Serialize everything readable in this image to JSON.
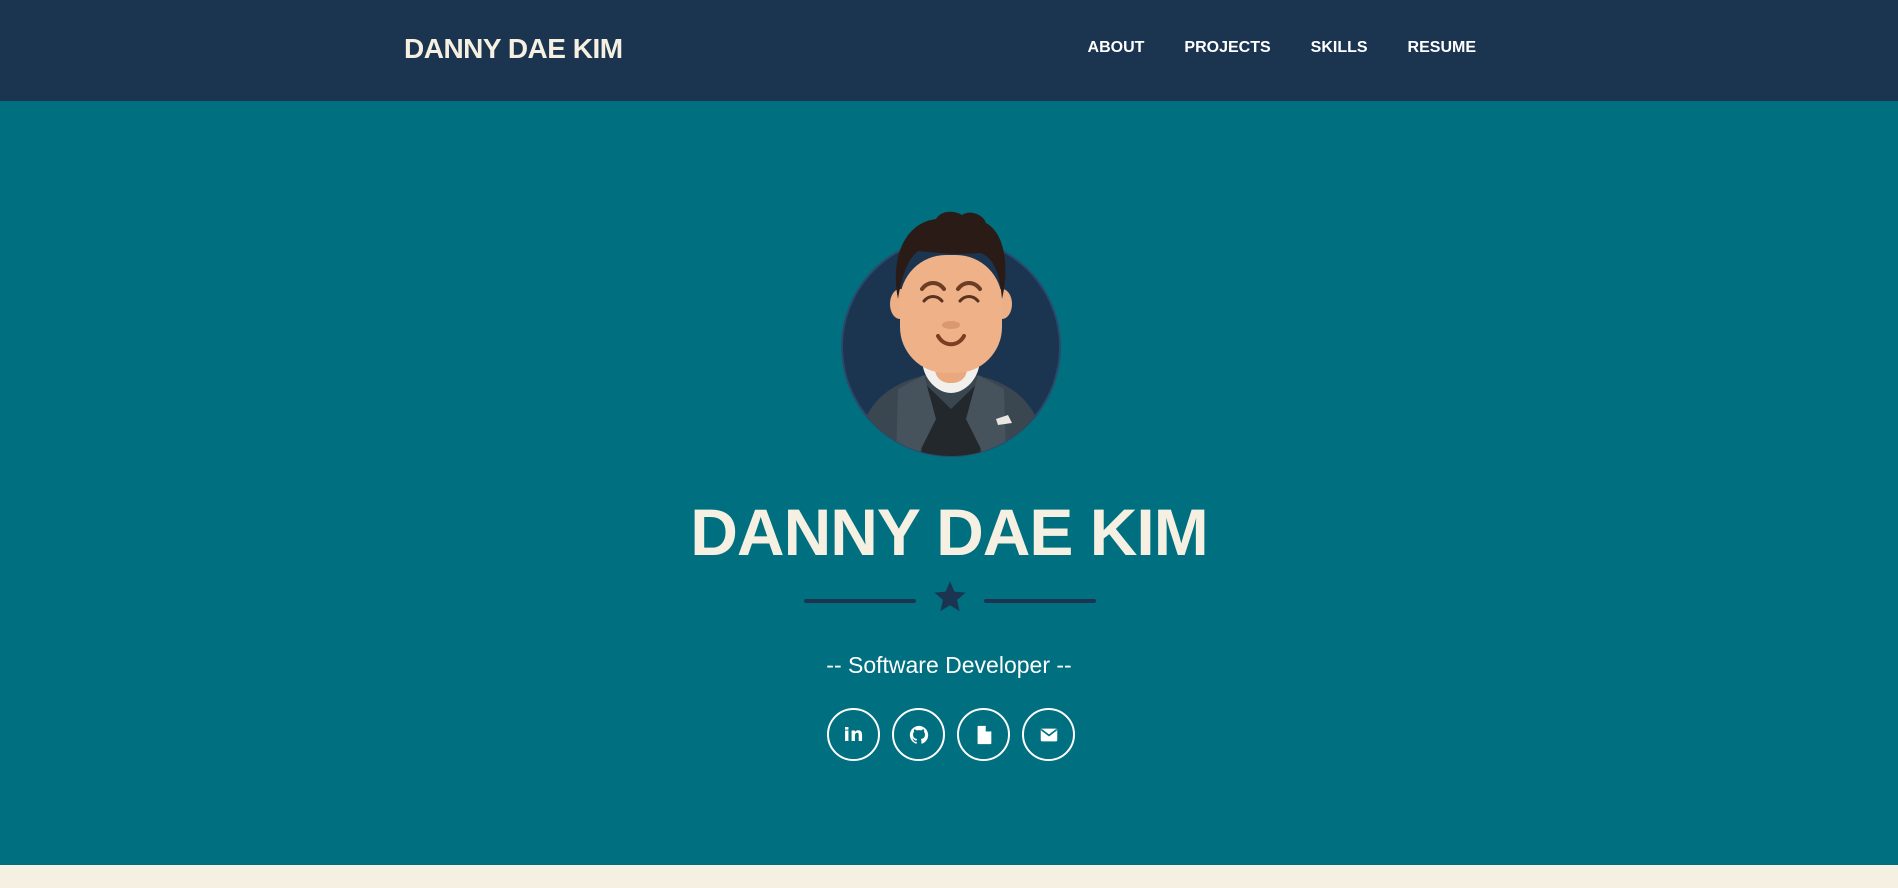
{
  "navbar": {
    "brand": "DANNY DAE KIM",
    "links": [
      "ABOUT",
      "PROJECTS",
      "SKILLS",
      "RESUME"
    ]
  },
  "hero": {
    "title": "DANNY DAE KIM",
    "subtitle": "-- Software Developer --",
    "social": [
      {
        "icon": "linkedin-icon",
        "text": "in"
      },
      {
        "icon": "github-icon"
      },
      {
        "icon": "document-icon"
      },
      {
        "icon": "envelope-icon"
      }
    ]
  },
  "colors": {
    "navbar_bg": "#1B3551",
    "hero_bg": "#006F7F",
    "cream": "#F5F0E1",
    "accent_dark": "#1B3551"
  }
}
